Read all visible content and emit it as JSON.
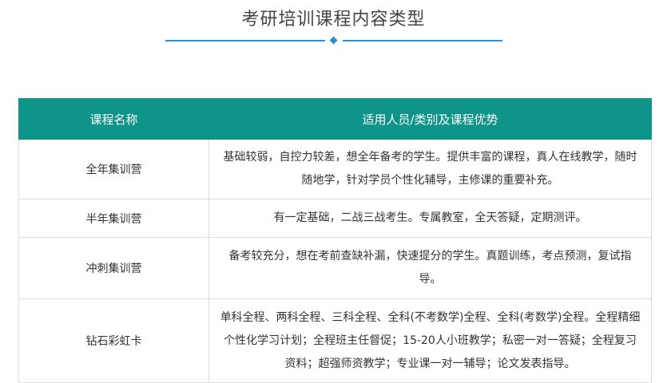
{
  "title": "考研培训课程内容类型",
  "colors": {
    "accent": "#2e8fd0",
    "header_bg": "#0e9488",
    "header_text": "#ffffff",
    "border": "#dcdcdc"
  },
  "table": {
    "headers": [
      "课程名称",
      "适用人员/类别及课程优势"
    ],
    "rows": [
      {
        "name": "全年集训营",
        "desc": "基础较弱，自控力较差，想全年备考的学生。提供丰富的课程，真人在线教学，随时随地学，针对学员个性化辅导，主修课的重要补充。"
      },
      {
        "name": "半年集训营",
        "desc": "有一定基础，二战三战考生。专属教室，全天答疑，定期测评。"
      },
      {
        "name": "冲刺集训营",
        "desc": "备考较充分，想在考前查缺补漏，快速提分的学生。真题训练，考点预测，复试指导。"
      },
      {
        "name": "钻石彩虹卡",
        "desc": "单科全程、两科全程、三科全程、全科(不考数学)全程、全科(考数学)全程。全程精细个性化学习计划；全程班主任督促；15-20人小班教学；私密一对一答疑；全程复习资料；超强师资教学；专业课一对一辅导；论文发表指导。"
      }
    ]
  }
}
